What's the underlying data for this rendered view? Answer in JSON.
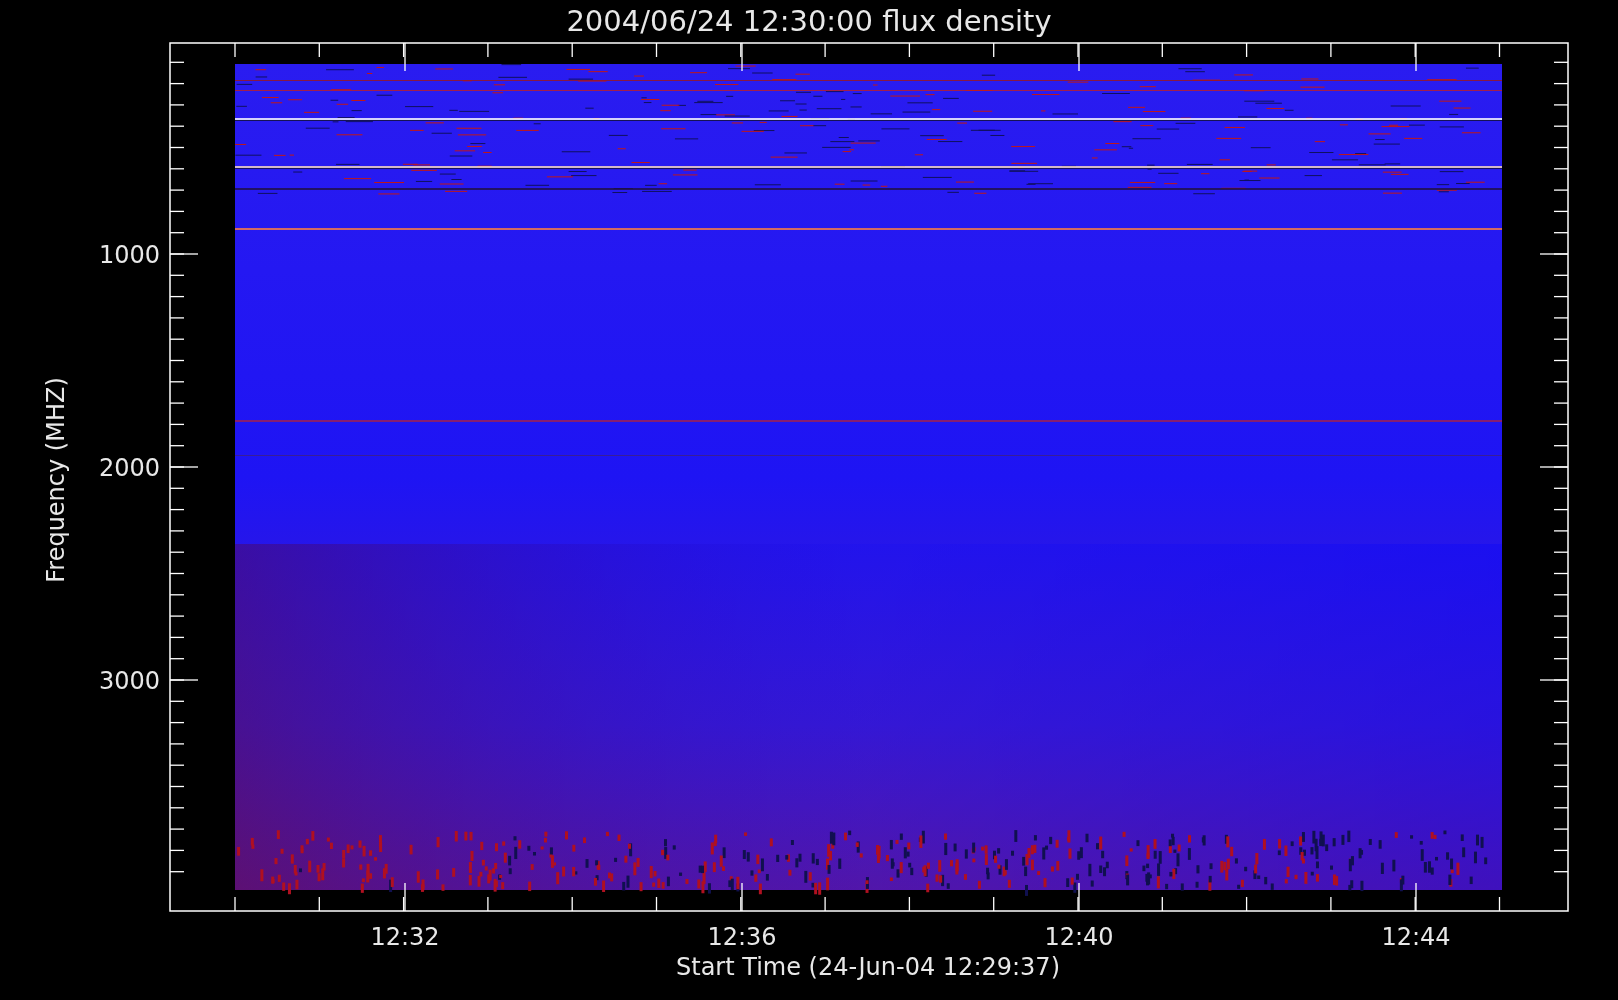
{
  "title": "2004/06/24 12:30:00 flux density",
  "y_axis": {
    "label": "Frequency (MHZ)",
    "ticks": [
      "1000",
      "2000",
      "3000"
    ]
  },
  "x_axis": {
    "label": "Start Time (24-Jun-04 12:29:37)",
    "ticks": [
      "12:32",
      "12:36",
      "12:40",
      "12:44"
    ]
  }
}
